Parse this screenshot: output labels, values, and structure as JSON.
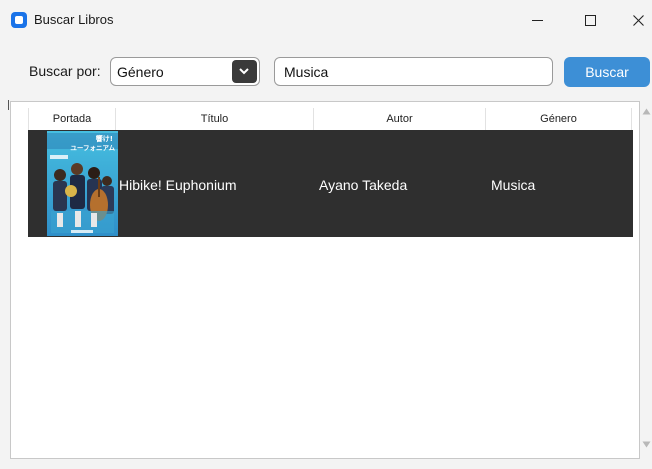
{
  "window": {
    "title": "Buscar Libros",
    "icon": "app-icon",
    "controls": [
      "minimize-icon",
      "maximize-icon",
      "close-icon"
    ]
  },
  "search": {
    "label": "Buscar por:",
    "field_selected": "Género",
    "query": "Musica",
    "button_label": "Buscar"
  },
  "table": {
    "headers": [
      "Portada",
      "Título",
      "Autor",
      "Género"
    ],
    "rows": [
      {
        "cover": "book-cover-image",
        "cover_text": "響け! ユーフォニアム",
        "title": "Hibike! Euphonium",
        "author": "Ayano Takeda",
        "genre": "Musica"
      }
    ]
  },
  "colors": {
    "accent": "#3d8fd6",
    "app_icon": "#1a73e8",
    "selected_row": "#2f2f2f",
    "cover_sky": "#3fb6d6"
  }
}
